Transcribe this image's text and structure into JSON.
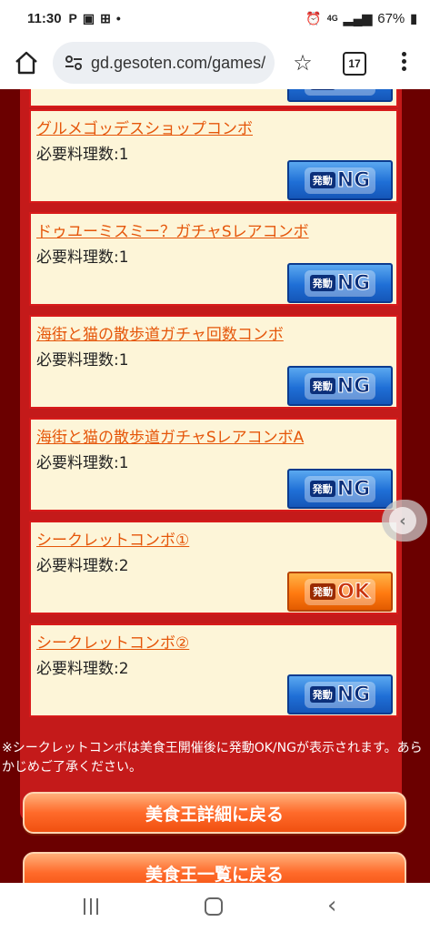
{
  "status_bar": {
    "time": "11:30",
    "notification_icons": [
      "parking-icon",
      "image-icon",
      "plus-box-icon",
      "dot-icon"
    ],
    "battery": "67%",
    "network": "4G"
  },
  "browser": {
    "url": "gd.gesoten.com/games/",
    "tab_count": "17"
  },
  "combos": [
    {
      "title": "グルメゴッデスショップコンボ",
      "req_label": "必要料理数:1",
      "status_prefix": "発動",
      "status": "NG"
    },
    {
      "title": "ドゥユーミスミー？ガチャSレアコンボ",
      "req_label": "必要料理数:1",
      "status_prefix": "発動",
      "status": "NG"
    },
    {
      "title": "海街と猫の散歩道ガチャ回数コンボ",
      "req_label": "必要料理数:1",
      "status_prefix": "発動",
      "status": "NG"
    },
    {
      "title": "海街と猫の散歩道ガチャSレアコンボA",
      "req_label": "必要料理数:1",
      "status_prefix": "発動",
      "status": "NG"
    },
    {
      "title": "シークレットコンボ①",
      "req_label": "必要料理数:2",
      "status_prefix": "発動",
      "status": "OK"
    },
    {
      "title": "シークレットコンボ②",
      "req_label": "必要料理数:2",
      "status_prefix": "発動",
      "status": "NG"
    }
  ],
  "top_partial": {
    "status_prefix": "発動",
    "status": "NG"
  },
  "note": "※シークレットコンボは美食王開催後に発動OK/NGが表示されます。あらかじめご了承ください。",
  "buttons": {
    "detail": "美食王詳細に戻る",
    "list": "美食王一覧に戻る"
  },
  "colors": {
    "background": "#6b0000",
    "panel": "#c41a1a",
    "card": "#fdf5d8",
    "title": "#e5560a",
    "ng": "#1f6fd6",
    "ok": "#ff7a10"
  }
}
